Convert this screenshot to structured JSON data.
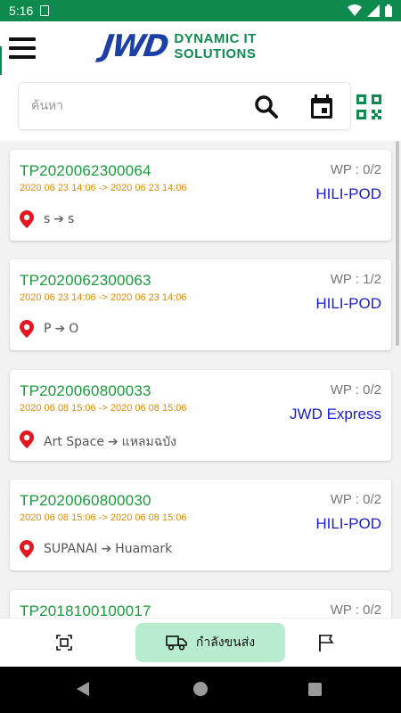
{
  "status_bar": {
    "time": "5:16"
  },
  "header": {
    "logo_text": "JWD",
    "tagline_line1": "DYNAMIC IT",
    "tagline_line2": "SOLUTIONS"
  },
  "search": {
    "placeholder": "ค้นหา"
  },
  "colors": {
    "brand_green": "#0f8a4f",
    "code_green": "#1a9b3a",
    "time_orange": "#e08a00",
    "carrier_blue": "#1a1ad4",
    "pin_red": "#e4161f",
    "active_tab_bg": "#b8ecd0"
  },
  "orders": [
    {
      "code": "TP2020062300064",
      "time_range": "2020 06 23 14:06 -> 2020 06 23 14:06",
      "wp": "WP : 0/2",
      "carrier": "HILI-POD",
      "origin": "s",
      "destination": "s"
    },
    {
      "code": "TP2020062300063",
      "time_range": "2020 06 23 14:06 -> 2020 06 23 14:06",
      "wp": "WP : 1/2",
      "carrier": "HILI-POD",
      "origin": "P",
      "destination": "O"
    },
    {
      "code": "TP2020060800033",
      "time_range": "2020 06 08 15:06 -> 2020 06 08 15:06",
      "wp": "WP : 0/2",
      "carrier": "JWD Express",
      "origin": "Art Space",
      "destination": "แหลมฉบัง"
    },
    {
      "code": "TP2020060800030",
      "time_range": "2020 06 08 15:06 -> 2020 06 08 15:06",
      "wp": "WP : 0/2",
      "carrier": "HILI-POD",
      "origin": "SUPANAI",
      "destination": "Huamark"
    },
    {
      "code": "TP2018100100017",
      "time_range": "",
      "wp": "WP : 0/2",
      "carrier": "",
      "origin": "",
      "destination": ""
    }
  ],
  "bottom_nav": {
    "active_label": "กำลังขนส่ง",
    "items": [
      "scan-icon",
      "truck-icon",
      "flag-icon"
    ]
  }
}
